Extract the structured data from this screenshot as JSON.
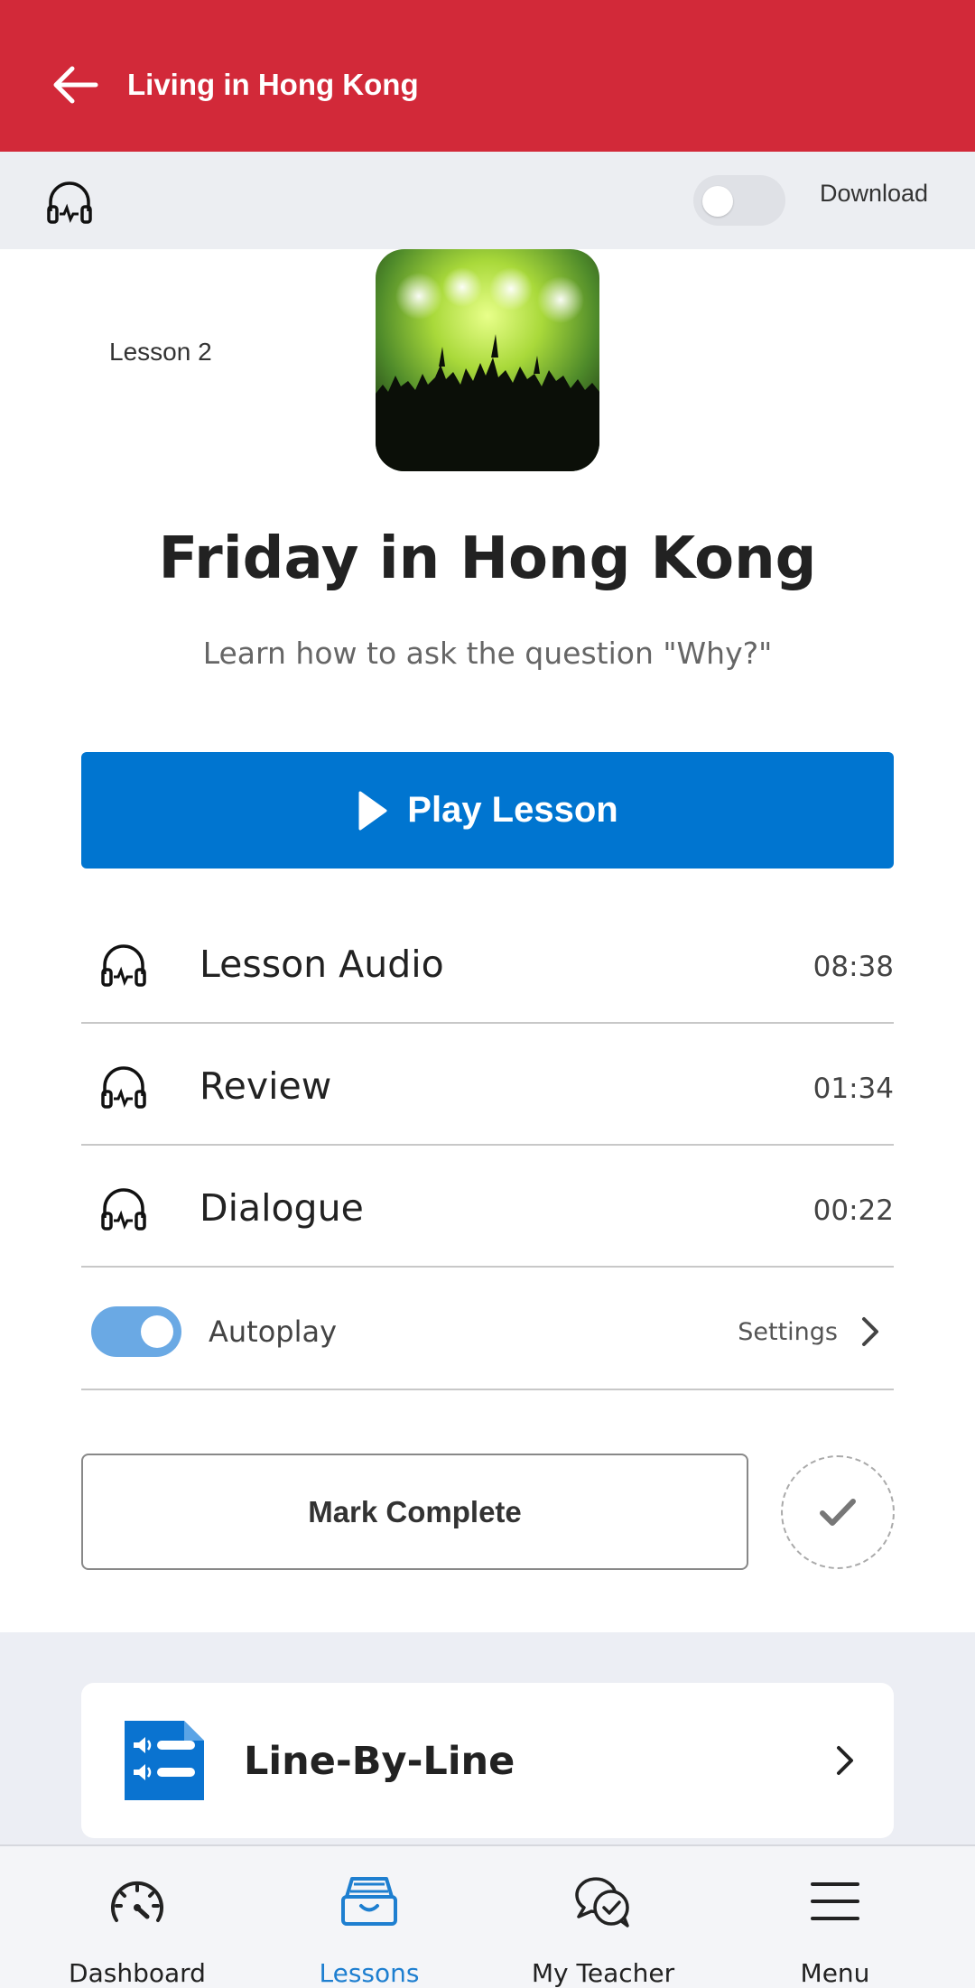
{
  "header": {
    "title": "Living in Hong Kong",
    "bg_color": "#d22939"
  },
  "subbar": {
    "lesson_label": "Lesson 2",
    "download_label": "Download",
    "download_enabled": false
  },
  "lesson": {
    "title": "Friday in Hong Kong",
    "subtitle": "Learn how to ask the question \"Why?\"",
    "play_label": "Play Lesson"
  },
  "tracks": [
    {
      "name": "Lesson Audio",
      "duration": "08:38",
      "icon": "headphones-icon"
    },
    {
      "name": "Review",
      "duration": "01:34",
      "icon": "headphones-icon"
    },
    {
      "name": "Dialogue",
      "duration": "00:22",
      "icon": "headphones-icon"
    }
  ],
  "autoplay": {
    "label": "Autoplay",
    "enabled": true,
    "settings_label": "Settings"
  },
  "actions": {
    "mark_complete_label": "Mark Complete"
  },
  "cards": [
    {
      "title": "Line-By-Line",
      "icon": "line-by-line-icon"
    }
  ],
  "bottom_nav": [
    {
      "label": "Dashboard",
      "icon": "dashboard-icon",
      "active": false
    },
    {
      "label": "Lessons",
      "icon": "lessons-icon",
      "active": true
    },
    {
      "label": "My Teacher",
      "icon": "my-teacher-icon",
      "active": false
    },
    {
      "label": "Menu",
      "icon": "menu-icon",
      "active": false
    }
  ],
  "colors": {
    "accent": "#0075d0",
    "active_nav": "#1e7fd0",
    "toggle_on": "#6aa9e4"
  }
}
